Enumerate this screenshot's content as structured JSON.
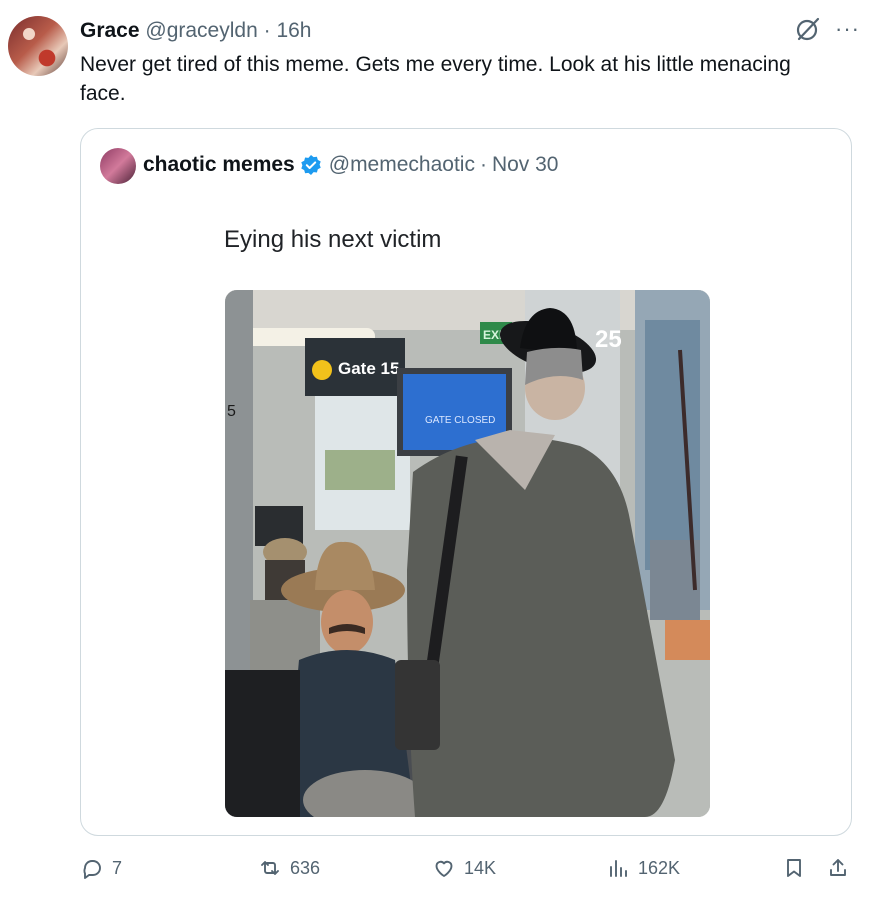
{
  "tweet": {
    "author_name": "Grace",
    "author_handle": "@graceyldn",
    "separator": "·",
    "time": "16h",
    "text": "Never get tired of this meme. Gets me every time. Look at his little menacing face."
  },
  "quote": {
    "author_name": "chaotic memes",
    "author_handle": "@memechaotic",
    "separator": "·",
    "date": "Nov 30",
    "caption": "Eying his next victim",
    "image_text": {
      "gate_sign": "Gate 15",
      "exit_sign": "EXIT",
      "board_status": "GATE CLOSED",
      "pillar_number": "25",
      "left_number": "5"
    }
  },
  "actions": {
    "replies": "7",
    "reposts": "636",
    "likes": "14K",
    "views": "162K"
  },
  "icons": {
    "top_right": [
      "grok-icon",
      "more-icon"
    ],
    "action_bar": [
      "reply-icon",
      "repost-icon",
      "like-icon",
      "views-icon",
      "bookmark-icon",
      "share-icon"
    ]
  },
  "colors": {
    "text": "#0f1419",
    "secondary": "#536471",
    "border": "#cfd9de",
    "verified": "#1d9bf0"
  }
}
